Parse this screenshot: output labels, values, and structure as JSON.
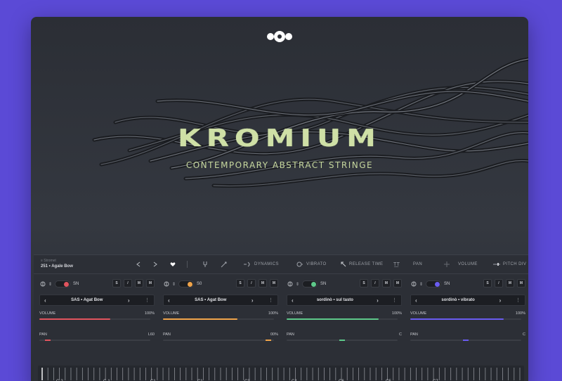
{
  "app": {
    "title": "KROMIUM",
    "subtitle": "CONTEMPORARY ABSTRACT STRINGE",
    "logo_icon": "wave-circles-logo",
    "title_color": "#cfe0a6"
  },
  "toolbar": {
    "preset_small": "≡ Stromet",
    "preset_name": "251 • Agale Bow",
    "items": [
      "DYNAMICS",
      "VIBRATO",
      "RELEASE TIME",
      "PAN",
      "VOLUME",
      "PITCH DIV"
    ]
  },
  "channels": [
    {
      "sn": "SN",
      "articulation": "SAS • Agat Bow",
      "volume_label": "VOLUME",
      "volume_value": "100%",
      "volume_level": 0.64,
      "pan_label": "PAN",
      "pan_value": "L60",
      "pan_level": 0.05,
      "color": "#e0545e",
      "buttons": [
        "S",
        "/",
        "M",
        "M"
      ]
    },
    {
      "sn": "S0",
      "articulation": "SAS • Agat Bow",
      "volume_label": "VOLUME",
      "volume_value": "100%",
      "volume_level": 0.67,
      "pan_label": "PAN",
      "pan_value": "00%",
      "pan_level": 0.97,
      "color": "#f0a44a",
      "buttons": [
        "S",
        "/",
        "M",
        "M"
      ]
    },
    {
      "sn": "SN",
      "articulation": "sordinò • sul tasto",
      "volume_label": "VOLUME",
      "volume_value": "100%",
      "volume_level": 0.83,
      "pan_label": "PAN",
      "pan_value": "C",
      "pan_level": 0.5,
      "color": "#5ec98a",
      "buttons": [
        "S",
        "/",
        "M",
        "M"
      ]
    },
    {
      "sn": "SN",
      "articulation": "sordinò • vibrato",
      "volume_label": "VOLUME",
      "volume_value": "100%",
      "volume_level": 0.84,
      "pan_label": "PAN",
      "pan_value": "C",
      "pan_level": 0.5,
      "color": "#6a5cf0",
      "buttons": [
        "S",
        "/",
        "M",
        "M"
      ]
    }
  ],
  "keyboard": {
    "notes": [
      "C-2",
      "C-1",
      "C1",
      "C1",
      "C3",
      "C4",
      "C6",
      "C5",
      "C7"
    ]
  }
}
